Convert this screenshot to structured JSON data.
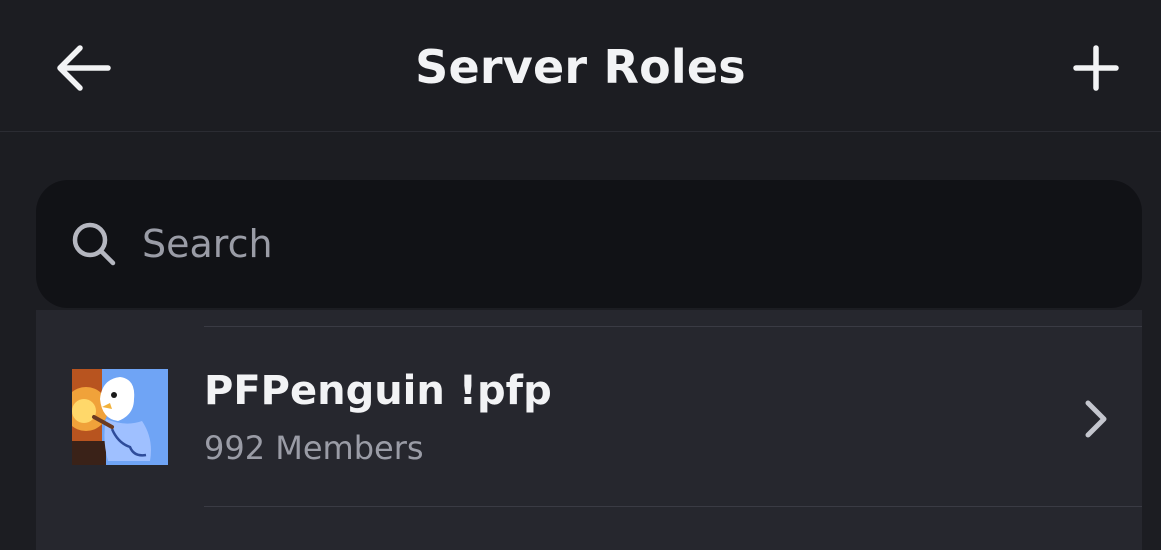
{
  "header": {
    "title": "Server Roles",
    "back_icon": "arrow-left-icon",
    "add_icon": "plus-icon"
  },
  "search": {
    "placeholder": "Search",
    "value": "",
    "icon": "search-icon"
  },
  "roles": [
    {
      "name": "PFPenguin !pfp",
      "members": "992 Members",
      "avatar": "penguin-avatar",
      "chevron_icon": "chevron-right-icon"
    }
  ],
  "colors": {
    "background": "#1c1d22",
    "search_bg": "#111216",
    "list_bg": "#26272e",
    "text_primary": "#f2f3f5",
    "text_muted": "#9a9ca6"
  }
}
